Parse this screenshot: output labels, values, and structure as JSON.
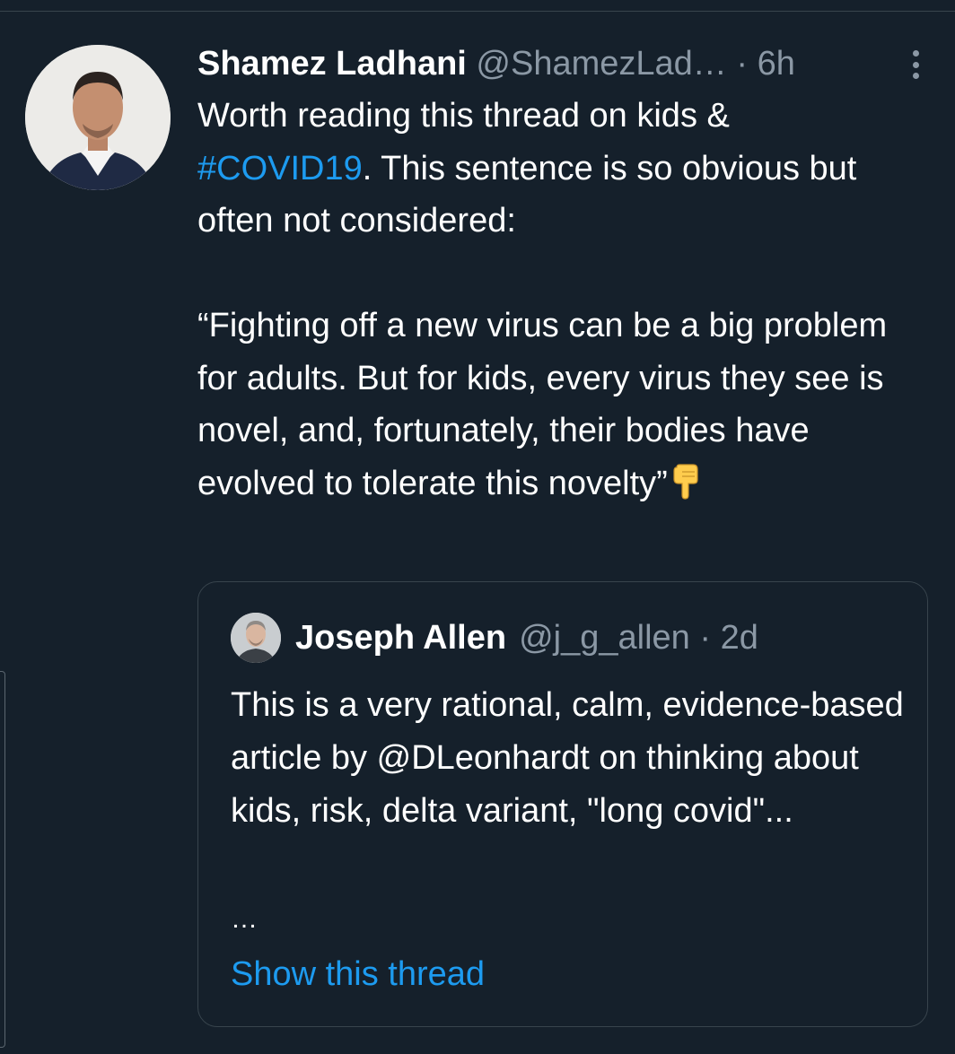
{
  "tweet": {
    "author_name": "Shamez Ladhani",
    "author_handle": "@ShamezLad…",
    "separator": "·",
    "time": "6h",
    "text_part1": "Worth reading this thread on kids &",
    "hashtag": "#COVID19",
    "text_part2": ". This sentence is so obvious but often not considered:",
    "quote_text": "“Fighting off a new virus can be a big problem for adults. But for kids, every virus they see is novel, and, fortunately, their bodies have evolved to tolerate this novelty”",
    "emoji_icon": "backhand-index-pointing-down-icon"
  },
  "quoted_tweet": {
    "author_name": "Joseph Allen",
    "author_handle": "@j_g_allen",
    "separator": "·",
    "time": "2d",
    "text": "This is a very rational, calm, evidence-based article by @DLeonhardt on thinking about kids, risk, delta variant, \"long covid\"...",
    "ellipsis": "…",
    "show_thread_label": "Show this thread"
  },
  "colors": {
    "background": "#15202b",
    "text": "#ffffff",
    "secondary_text": "#8b98a5",
    "link": "#1d9bf0",
    "border": "#38444d"
  }
}
